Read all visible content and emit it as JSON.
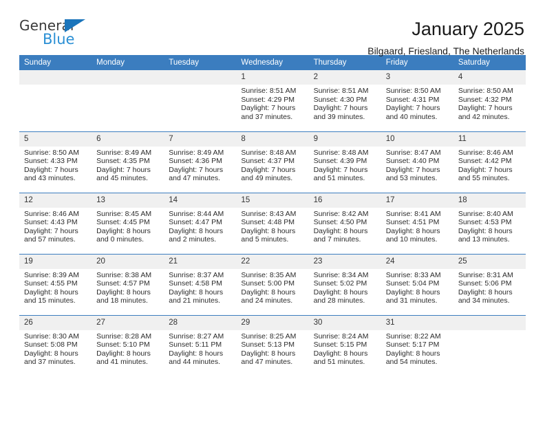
{
  "logo": {
    "word_one": "General",
    "word_two": "Blue",
    "triangle_color": "#1b75bb",
    "blue_color": "#2a8fd4"
  },
  "header": {
    "title": "January 2025",
    "subtitle": "Bilgaard, Friesland, The Netherlands"
  },
  "theme": {
    "header_bg": "#3b7dbf",
    "daynum_bg": "#f0f0f0",
    "text": "#2b2b2b"
  },
  "weekdays": [
    "Sunday",
    "Monday",
    "Tuesday",
    "Wednesday",
    "Thursday",
    "Friday",
    "Saturday"
  ],
  "weeks": [
    [
      {
        "day": "",
        "sunrise": "",
        "sunset": "",
        "daylight_line1": "",
        "daylight_line2": ""
      },
      {
        "day": "",
        "sunrise": "",
        "sunset": "",
        "daylight_line1": "",
        "daylight_line2": ""
      },
      {
        "day": "",
        "sunrise": "",
        "sunset": "",
        "daylight_line1": "",
        "daylight_line2": ""
      },
      {
        "day": "1",
        "sunrise": "Sunrise: 8:51 AM",
        "sunset": "Sunset: 4:29 PM",
        "daylight_line1": "Daylight: 7 hours",
        "daylight_line2": "and 37 minutes."
      },
      {
        "day": "2",
        "sunrise": "Sunrise: 8:51 AM",
        "sunset": "Sunset: 4:30 PM",
        "daylight_line1": "Daylight: 7 hours",
        "daylight_line2": "and 39 minutes."
      },
      {
        "day": "3",
        "sunrise": "Sunrise: 8:50 AM",
        "sunset": "Sunset: 4:31 PM",
        "daylight_line1": "Daylight: 7 hours",
        "daylight_line2": "and 40 minutes."
      },
      {
        "day": "4",
        "sunrise": "Sunrise: 8:50 AM",
        "sunset": "Sunset: 4:32 PM",
        "daylight_line1": "Daylight: 7 hours",
        "daylight_line2": "and 42 minutes."
      }
    ],
    [
      {
        "day": "5",
        "sunrise": "Sunrise: 8:50 AM",
        "sunset": "Sunset: 4:33 PM",
        "daylight_line1": "Daylight: 7 hours",
        "daylight_line2": "and 43 minutes."
      },
      {
        "day": "6",
        "sunrise": "Sunrise: 8:49 AM",
        "sunset": "Sunset: 4:35 PM",
        "daylight_line1": "Daylight: 7 hours",
        "daylight_line2": "and 45 minutes."
      },
      {
        "day": "7",
        "sunrise": "Sunrise: 8:49 AM",
        "sunset": "Sunset: 4:36 PM",
        "daylight_line1": "Daylight: 7 hours",
        "daylight_line2": "and 47 minutes."
      },
      {
        "day": "8",
        "sunrise": "Sunrise: 8:48 AM",
        "sunset": "Sunset: 4:37 PM",
        "daylight_line1": "Daylight: 7 hours",
        "daylight_line2": "and 49 minutes."
      },
      {
        "day": "9",
        "sunrise": "Sunrise: 8:48 AM",
        "sunset": "Sunset: 4:39 PM",
        "daylight_line1": "Daylight: 7 hours",
        "daylight_line2": "and 51 minutes."
      },
      {
        "day": "10",
        "sunrise": "Sunrise: 8:47 AM",
        "sunset": "Sunset: 4:40 PM",
        "daylight_line1": "Daylight: 7 hours",
        "daylight_line2": "and 53 minutes."
      },
      {
        "day": "11",
        "sunrise": "Sunrise: 8:46 AM",
        "sunset": "Sunset: 4:42 PM",
        "daylight_line1": "Daylight: 7 hours",
        "daylight_line2": "and 55 minutes."
      }
    ],
    [
      {
        "day": "12",
        "sunrise": "Sunrise: 8:46 AM",
        "sunset": "Sunset: 4:43 PM",
        "daylight_line1": "Daylight: 7 hours",
        "daylight_line2": "and 57 minutes."
      },
      {
        "day": "13",
        "sunrise": "Sunrise: 8:45 AM",
        "sunset": "Sunset: 4:45 PM",
        "daylight_line1": "Daylight: 8 hours",
        "daylight_line2": "and 0 minutes."
      },
      {
        "day": "14",
        "sunrise": "Sunrise: 8:44 AM",
        "sunset": "Sunset: 4:47 PM",
        "daylight_line1": "Daylight: 8 hours",
        "daylight_line2": "and 2 minutes."
      },
      {
        "day": "15",
        "sunrise": "Sunrise: 8:43 AM",
        "sunset": "Sunset: 4:48 PM",
        "daylight_line1": "Daylight: 8 hours",
        "daylight_line2": "and 5 minutes."
      },
      {
        "day": "16",
        "sunrise": "Sunrise: 8:42 AM",
        "sunset": "Sunset: 4:50 PM",
        "daylight_line1": "Daylight: 8 hours",
        "daylight_line2": "and 7 minutes."
      },
      {
        "day": "17",
        "sunrise": "Sunrise: 8:41 AM",
        "sunset": "Sunset: 4:51 PM",
        "daylight_line1": "Daylight: 8 hours",
        "daylight_line2": "and 10 minutes."
      },
      {
        "day": "18",
        "sunrise": "Sunrise: 8:40 AM",
        "sunset": "Sunset: 4:53 PM",
        "daylight_line1": "Daylight: 8 hours",
        "daylight_line2": "and 13 minutes."
      }
    ],
    [
      {
        "day": "19",
        "sunrise": "Sunrise: 8:39 AM",
        "sunset": "Sunset: 4:55 PM",
        "daylight_line1": "Daylight: 8 hours",
        "daylight_line2": "and 15 minutes."
      },
      {
        "day": "20",
        "sunrise": "Sunrise: 8:38 AM",
        "sunset": "Sunset: 4:57 PM",
        "daylight_line1": "Daylight: 8 hours",
        "daylight_line2": "and 18 minutes."
      },
      {
        "day": "21",
        "sunrise": "Sunrise: 8:37 AM",
        "sunset": "Sunset: 4:58 PM",
        "daylight_line1": "Daylight: 8 hours",
        "daylight_line2": "and 21 minutes."
      },
      {
        "day": "22",
        "sunrise": "Sunrise: 8:35 AM",
        "sunset": "Sunset: 5:00 PM",
        "daylight_line1": "Daylight: 8 hours",
        "daylight_line2": "and 24 minutes."
      },
      {
        "day": "23",
        "sunrise": "Sunrise: 8:34 AM",
        "sunset": "Sunset: 5:02 PM",
        "daylight_line1": "Daylight: 8 hours",
        "daylight_line2": "and 28 minutes."
      },
      {
        "day": "24",
        "sunrise": "Sunrise: 8:33 AM",
        "sunset": "Sunset: 5:04 PM",
        "daylight_line1": "Daylight: 8 hours",
        "daylight_line2": "and 31 minutes."
      },
      {
        "day": "25",
        "sunrise": "Sunrise: 8:31 AM",
        "sunset": "Sunset: 5:06 PM",
        "daylight_line1": "Daylight: 8 hours",
        "daylight_line2": "and 34 minutes."
      }
    ],
    [
      {
        "day": "26",
        "sunrise": "Sunrise: 8:30 AM",
        "sunset": "Sunset: 5:08 PM",
        "daylight_line1": "Daylight: 8 hours",
        "daylight_line2": "and 37 minutes."
      },
      {
        "day": "27",
        "sunrise": "Sunrise: 8:28 AM",
        "sunset": "Sunset: 5:10 PM",
        "daylight_line1": "Daylight: 8 hours",
        "daylight_line2": "and 41 minutes."
      },
      {
        "day": "28",
        "sunrise": "Sunrise: 8:27 AM",
        "sunset": "Sunset: 5:11 PM",
        "daylight_line1": "Daylight: 8 hours",
        "daylight_line2": "and 44 minutes."
      },
      {
        "day": "29",
        "sunrise": "Sunrise: 8:25 AM",
        "sunset": "Sunset: 5:13 PM",
        "daylight_line1": "Daylight: 8 hours",
        "daylight_line2": "and 47 minutes."
      },
      {
        "day": "30",
        "sunrise": "Sunrise: 8:24 AM",
        "sunset": "Sunset: 5:15 PM",
        "daylight_line1": "Daylight: 8 hours",
        "daylight_line2": "and 51 minutes."
      },
      {
        "day": "31",
        "sunrise": "Sunrise: 8:22 AM",
        "sunset": "Sunset: 5:17 PM",
        "daylight_line1": "Daylight: 8 hours",
        "daylight_line2": "and 54 minutes."
      },
      {
        "day": "",
        "sunrise": "",
        "sunset": "",
        "daylight_line1": "",
        "daylight_line2": ""
      }
    ]
  ]
}
